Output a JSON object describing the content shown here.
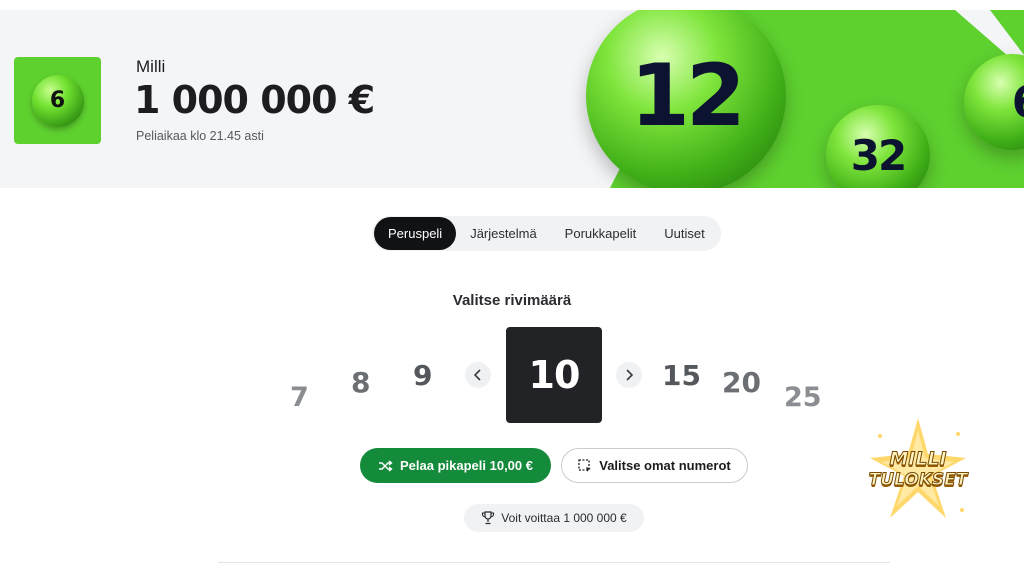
{
  "banner": {
    "logo_number": "6",
    "game_name": "Milli",
    "jackpot": "1 000 000 €",
    "deadline": "Peliaikaa klo 21.45 asti",
    "balls": [
      "12",
      "32",
      "6"
    ],
    "accent_color": "#5ed12f"
  },
  "tabs": [
    {
      "label": "Peruspeli",
      "active": true
    },
    {
      "label": "Järjestelmä",
      "active": false
    },
    {
      "label": "Porukkapelit",
      "active": false
    },
    {
      "label": "Uutiset",
      "active": false
    }
  ],
  "row_selector": {
    "title": "Valitse rivimäärä",
    "options": [
      "7",
      "8",
      "9",
      "10",
      "15",
      "20",
      "25"
    ],
    "selected": "10",
    "prev_icon": "chevron-left-icon",
    "next_icon": "chevron-right-icon"
  },
  "actions": {
    "quick_play_label": "Pelaa pikapeli 10,00 €",
    "quick_play_icon": "shuffle-icon",
    "quick_play_color": "#148a3b",
    "own_numbers_label": "Valitse omat numerot",
    "own_numbers_icon": "select-icon"
  },
  "win_info": {
    "label": "Voit voittaa 1 000 000 €",
    "icon": "trophy-icon"
  },
  "watermark": {
    "line1": "MILLI",
    "line2": "TULOKSET"
  }
}
